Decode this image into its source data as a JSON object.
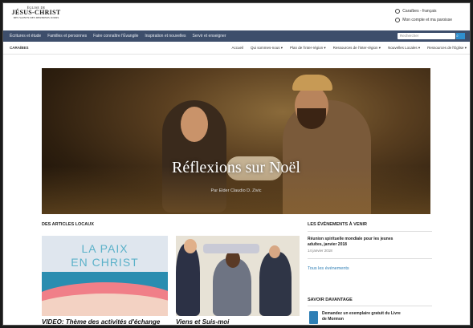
{
  "header": {
    "logo_line1": "ÉGLISE DE",
    "logo_line2": "JÉSUS-CHRIST",
    "logo_line3": "DES SAINTS DES DERNIERS JOURS",
    "region_lang": "Caraïbes - français",
    "account": "Mon compte et ma paroisse"
  },
  "nav": {
    "items": [
      "Écritures et étude",
      "Familles et personnes",
      "Faire connaître l'Évangile",
      "Inspiration et nouvelles",
      "Servir et enseigner"
    ],
    "search_placeholder": "Rechercher"
  },
  "subnav": {
    "region": "CARAÏBES",
    "links": [
      "Accueil",
      "Qui sommes-nous ▾",
      "Plan de l'inter-région ▾",
      "Ressources de l'inter-région ▾",
      "Nouvelles Locales ▾",
      "Ressources de l'Église ▾"
    ]
  },
  "hero": {
    "title": "Réflexions sur Noël",
    "byline": "Par Elder Claudio D. Zivic"
  },
  "articles": {
    "section_title": "DES ARTICLES LOCAUX",
    "card1_text_line1": "LA PAIX",
    "card1_text_line2": "EN CHRIST",
    "card1_caption": "VIDEO: Thème des activités d'échange",
    "card2_caption": "Viens et Suis-moi"
  },
  "events": {
    "section_title": "LES ÉVÉNEMENTS À VENIR",
    "event_title_line1": "Réunion spirituelle mondiale pour les jeunes",
    "event_title_line2": "adultes, janvier 2018",
    "event_date": "14 janvier 2018",
    "all_events": "Tous les événements"
  },
  "learn": {
    "section_title": "SAVOIR DAVANTAGE",
    "item_line1": "Demandez un exemplaire gratuit du Livre",
    "item_line2": "de Mormon"
  },
  "colors": {
    "nav_bg": "#3d4e6b",
    "accent": "#2f8fcf",
    "link": "#2f7fb5"
  }
}
